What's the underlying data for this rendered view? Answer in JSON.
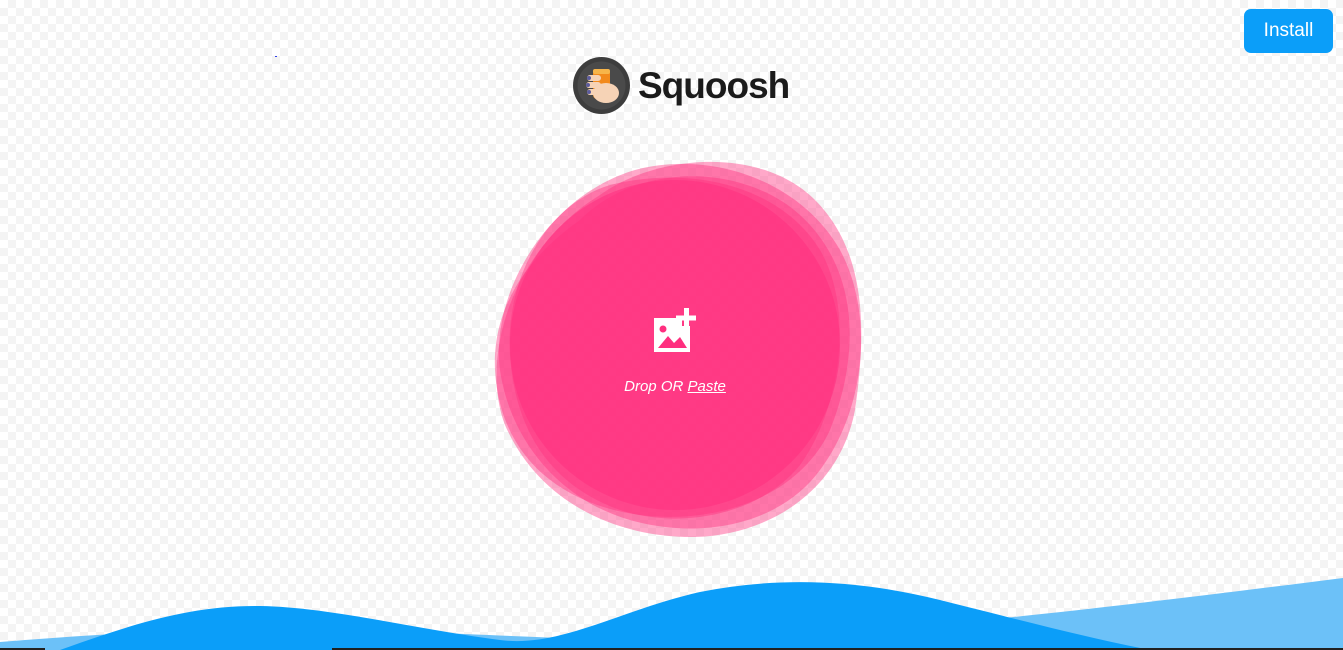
{
  "app": {
    "name": "Squoosh",
    "install_label": "Install"
  },
  "dropzone": {
    "drop_label": "Drop OR",
    "paste_label": "Paste"
  },
  "colors": {
    "blob": "#ff2f7f",
    "install_button": "#0b9ef9",
    "wave_front": "#0b9ef9",
    "wave_back": "#6cc1f8",
    "logo_text": "#1b1b1b"
  },
  "icons": {
    "logo": "squoosh-hand-logo-icon",
    "add_image": "add-image-icon"
  }
}
